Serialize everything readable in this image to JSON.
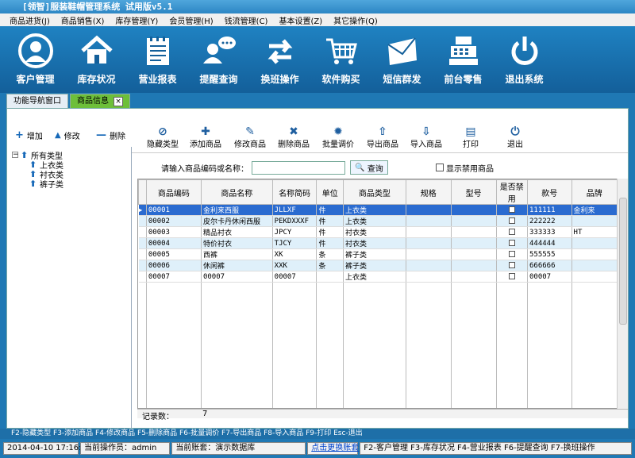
{
  "window": {
    "title": "[领智]服装鞋帽管理系统 试用版v5.1"
  },
  "menu": [
    "商品进货(J)",
    "商品销售(X)",
    "库存管理(Y)",
    "会员管理(H)",
    "钱流管理(C)",
    "基本设置(Z)",
    "其它操作(Q)"
  ],
  "toolbar": [
    {
      "label": "客户管理",
      "icon": "user-icon"
    },
    {
      "label": "库存状况",
      "icon": "house-icon"
    },
    {
      "label": "营业报表",
      "icon": "notepad-icon"
    },
    {
      "label": "提醒查询",
      "icon": "chat-user-icon"
    },
    {
      "label": "换班操作",
      "icon": "swap-icon"
    },
    {
      "label": "软件购买",
      "icon": "cart-icon"
    },
    {
      "label": "短信群发",
      "icon": "mail-icon"
    },
    {
      "label": "前台零售",
      "icon": "register-icon"
    },
    {
      "label": "退出系统",
      "icon": "power-icon"
    }
  ],
  "tabs": [
    {
      "label": "功能导航窗口"
    },
    {
      "label": "商品信息"
    }
  ],
  "leftActions": [
    {
      "label": "增加",
      "icon": "plus-icon"
    },
    {
      "label": "修改",
      "icon": "triangle-up-icon"
    },
    {
      "label": "删除",
      "icon": "minus-icon"
    }
  ],
  "actions": [
    {
      "label": "隐藏类型",
      "icon": "hide-icon"
    },
    {
      "label": "添加商品",
      "icon": "add-icon"
    },
    {
      "label": "修改商品",
      "icon": "edit-icon"
    },
    {
      "label": "删除商品",
      "icon": "delete-icon"
    },
    {
      "label": "批量调价",
      "icon": "gear-icon"
    },
    {
      "label": "导出商品",
      "icon": "export-icon"
    },
    {
      "label": "导入商品",
      "icon": "import-icon"
    },
    {
      "label": "打印",
      "icon": "printer-icon"
    },
    {
      "label": "退出",
      "icon": "power-icon"
    }
  ],
  "tree": {
    "root": "所有类型",
    "children": [
      "上衣类",
      "衬衣类",
      "裤子类"
    ]
  },
  "search": {
    "label": "请输入商品编码或名称：",
    "value": "",
    "button": "查询",
    "checkbox": "显示禁用商品"
  },
  "grid": {
    "columns": [
      "商品编码",
      "商品名称",
      "名称简码",
      "单位",
      "商品类型",
      "规格",
      "型号",
      "是否禁用",
      "款号",
      "品牌"
    ],
    "rows": [
      [
        "00001",
        "金利来西服",
        "JLLXF",
        "件",
        "上衣类",
        "",
        "",
        "",
        "111111",
        "金利来"
      ],
      [
        "00002",
        "皮尔卡丹休闲西服",
        "PEKDXXXF",
        "件",
        "上衣类",
        "",
        "",
        "",
        "222222",
        ""
      ],
      [
        "00003",
        "精品衬衣",
        "JPCY",
        "件",
        "衬衣类",
        "",
        "",
        "",
        "333333",
        "HT"
      ],
      [
        "00004",
        "特价衬衣",
        "TJCY",
        "件",
        "衬衣类",
        "",
        "",
        "",
        "444444",
        ""
      ],
      [
        "00005",
        "西裤",
        "XK",
        "条",
        "裤子类",
        "",
        "",
        "",
        "555555",
        ""
      ],
      [
        "00006",
        "休闲裤",
        "XXK",
        "条",
        "裤子类",
        "",
        "",
        "",
        "666666",
        ""
      ],
      [
        "00007",
        "00007",
        "00007",
        "",
        "上衣类",
        "",
        "",
        "",
        "00007",
        ""
      ]
    ],
    "recordLabel": "记录数：",
    "recordCount": "7"
  },
  "hints": "F2-隐藏类型  F3-添加商品  F4-修改商品  F5-删除商品  F6-批量调价  F7-导出商品  F8-导入商品  F9-打印  Esc-退出",
  "status": {
    "datetime": "2014-04-10 17:16:48",
    "operator": "当前操作员：admin",
    "account": "当前账套：演示数据库",
    "switchLink": "点击更换账套",
    "shortcuts": "F2-客户管理  F3-库存状况  F4-营业报表  F6-提醒查询  F7-换班操作"
  }
}
